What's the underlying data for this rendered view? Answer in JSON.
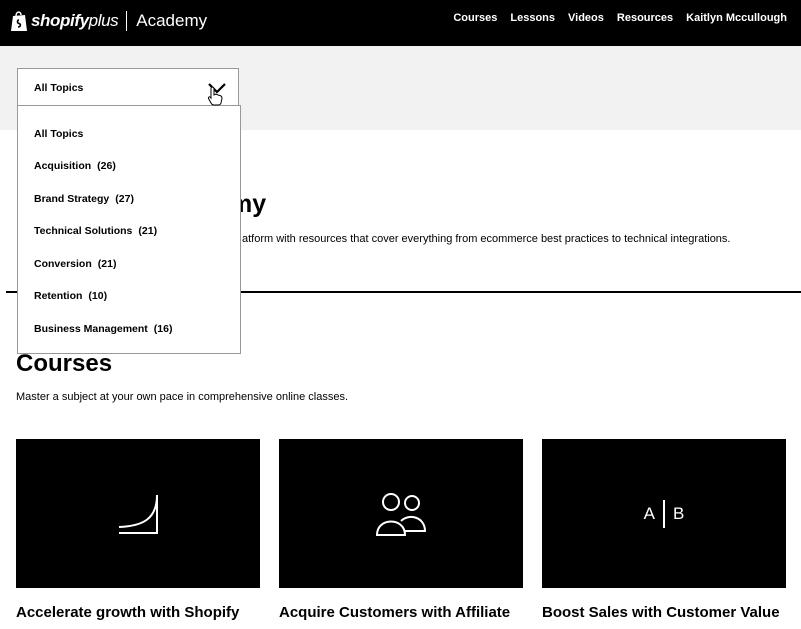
{
  "header": {
    "brand_bold": "shopify",
    "brand_plus": "plus",
    "section": "Academy",
    "nav": [
      "Courses",
      "Lessons",
      "Videos",
      "Resources",
      "Kaitlyn Mccullough"
    ]
  },
  "filter": {
    "selected": "All Topics",
    "options": [
      {
        "label": "All Topics",
        "count": ""
      },
      {
        "label": "Acquisition",
        "count": "(26)"
      },
      {
        "label": "Brand Strategy",
        "count": "(27)"
      },
      {
        "label": "Technical Solutions",
        "count": "(21)"
      },
      {
        "label": "Conversion",
        "count": "(21)"
      },
      {
        "label": "Retention",
        "count": "(10)"
      },
      {
        "label": "Business Management",
        "count": "(16)"
      }
    ]
  },
  "hero": {
    "title_visible": "my",
    "description_visible": "atform with resources that cover everything from ecommerce best practices to technical integrations."
  },
  "courses": {
    "title": "Courses",
    "subtitle": "Master a subject at your own pace in comprehensive online classes.",
    "cards": [
      {
        "title": "Accelerate growth with Shopify",
        "icon": "growth-curve-icon"
      },
      {
        "title": "Acquire Customers with Affiliate",
        "icon": "people-icon"
      },
      {
        "title": "Boost Sales with Customer Value",
        "icon": "ab-test-icon",
        "icon_text_a": "A",
        "icon_text_b": "B"
      }
    ]
  },
  "colors": {
    "topbar": "#000000",
    "band": "#f2f2f2",
    "card": "#000000",
    "border": "#999999"
  }
}
